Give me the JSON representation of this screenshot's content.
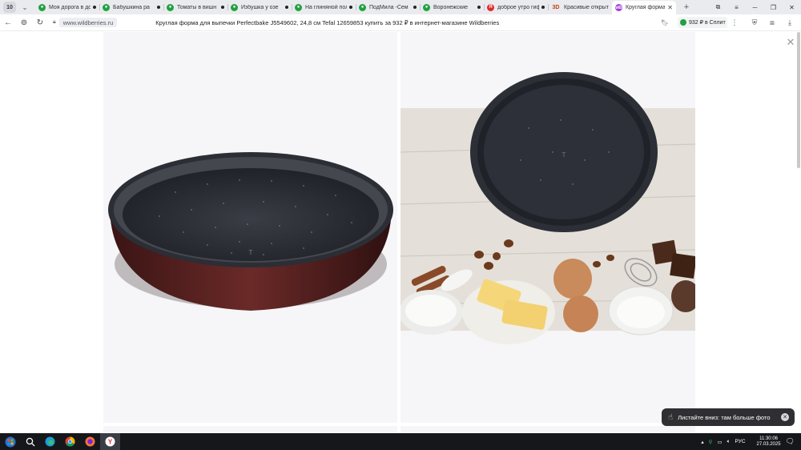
{
  "browser": {
    "tab_count": "10",
    "tabs": [
      {
        "title": "Моя дорога в дотс",
        "favicon": "green",
        "dot": true
      },
      {
        "title": "Бабушкина ра",
        "favicon": "green",
        "dot": true
      },
      {
        "title": "Томаты в вишн",
        "favicon": "green",
        "dot": true
      },
      {
        "title": "Избушка у озе",
        "favicon": "green",
        "dot": true
      },
      {
        "title": "На глиняной полу",
        "favicon": "green",
        "dot": true
      },
      {
        "title": "ПодМила -Сем",
        "favicon": "green",
        "dot": true
      },
      {
        "title": "Воронежские",
        "favicon": "green",
        "dot": true
      },
      {
        "title": "доброе утро гифк",
        "favicon": "red",
        "dot": true
      },
      {
        "title": "Красивые открыт",
        "favicon": "3d",
        "dot": false
      },
      {
        "title": "Круглая форма",
        "favicon": "purple",
        "dot": false,
        "active": true
      }
    ],
    "url_host": "www.wildberries.ru",
    "page_title": "Круглая форма для выпечки Perfectbake J5549602, 24,8 см Tefal 12659853 купить за 932 ₽ в интернет-магазине Wildberries",
    "split_label": "932 ₽ в Сплит"
  },
  "viewer": {
    "hint_text": "Листайте вниз: там больше фото"
  },
  "taskbar": {
    "lang": "РУС",
    "time": "11:30:06",
    "date": "27.03.2025"
  },
  "colors": {
    "pan_outer": "#4a1c1c",
    "pan_inner": "#2a2d33",
    "wood": "#e3dfd8",
    "accent_wb": "#a33cdc"
  }
}
